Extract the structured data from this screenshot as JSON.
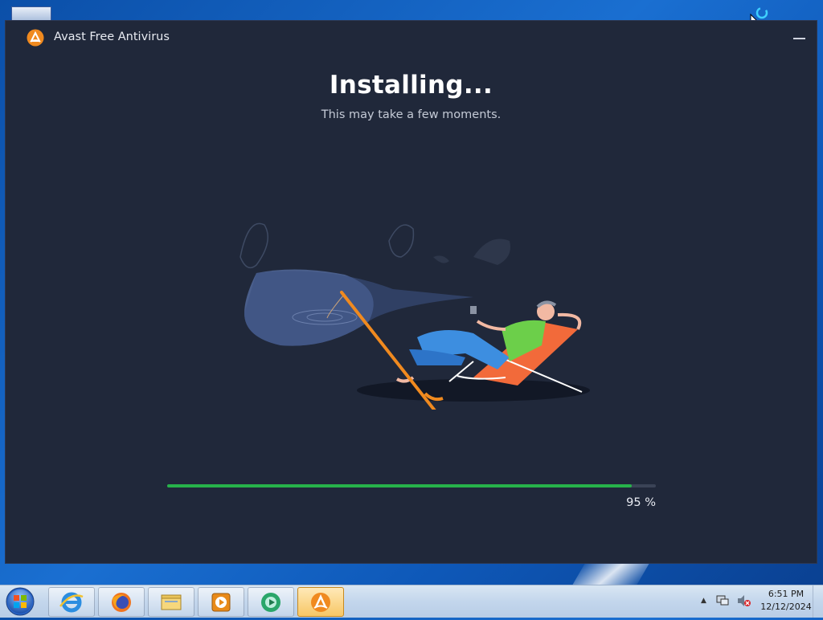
{
  "window": {
    "title": "Avast Free Antivirus",
    "minimize_label": "—"
  },
  "install": {
    "heading": "Installing...",
    "subheading": "This may take a few moments.",
    "progress_percent": 95,
    "progress_text": "95 %"
  },
  "colors": {
    "window_bg": "#20283a",
    "progress_fill": "#27b24a",
    "progress_track": "#3a4356",
    "brand_orange": "#f08a1f"
  },
  "taskbar": {
    "start_icon": "windows-logo-icon",
    "apps": [
      {
        "name": "internet-explorer",
        "icon": "ie-icon"
      },
      {
        "name": "firefox",
        "icon": "firefox-icon"
      },
      {
        "name": "file-explorer",
        "icon": "folder-icon"
      },
      {
        "name": "media-player",
        "icon": "media-player-icon"
      },
      {
        "name": "app",
        "icon": "green-circle-icon"
      },
      {
        "name": "avast",
        "icon": "avast-icon",
        "active": true
      }
    ],
    "clock": {
      "time": "6:51 PM",
      "date": "12/12/2024"
    }
  }
}
